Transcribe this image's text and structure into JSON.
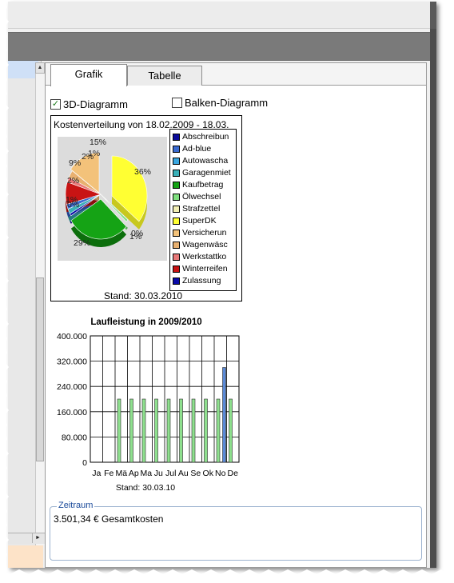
{
  "tabs": [
    {
      "label": "Grafik",
      "active": true
    },
    {
      "label": "Tabelle",
      "active": false
    }
  ],
  "options": {
    "diagram_3d": {
      "label": "3D-Diagramm",
      "checked": true
    },
    "balken": {
      "label": "Balken-Diagramm",
      "checked": false
    }
  },
  "pie": {
    "title": "Kostenverteilung von 18.02.2009 - 18.03.",
    "stand": "Stand: 30.03.2010",
    "slice_labels": [
      "15%",
      "2%",
      "1%",
      "9%",
      "2%",
      "1%",
      "0%",
      "36%",
      "29%",
      "1%",
      "0%"
    ],
    "legend": [
      {
        "label": "Abschreibun",
        "color": "#0a0a9a"
      },
      {
        "label": "Ad-blue",
        "color": "#3a6ad0"
      },
      {
        "label": "Autowascha",
        "color": "#3aa6e0"
      },
      {
        "label": "Garagenmiet",
        "color": "#3ab0b8"
      },
      {
        "label": "Kaufbetrag",
        "color": "#15a315"
      },
      {
        "label": "Ölwechsel",
        "color": "#7fe07f"
      },
      {
        "label": "Strafzettel",
        "color": "#f3efb4"
      },
      {
        "label": "SuperDK",
        "color": "#ffff33"
      },
      {
        "label": "Versicherun",
        "color": "#f3c27a"
      },
      {
        "label": "Wagenwäsc",
        "color": "#e8b070"
      },
      {
        "label": "Werkstattko",
        "color": "#e87878"
      },
      {
        "label": "Winterreifen",
        "color": "#c81414"
      },
      {
        "label": "Zulassung",
        "color": "#0a0aa8"
      }
    ]
  },
  "chart_data": {
    "type": "bar",
    "title": "Laufleistung in 2009/2010",
    "categories": [
      "Ja",
      "Fe",
      "Mä",
      "Ap",
      "Ma",
      "Ju",
      "Jul",
      "Au",
      "Se",
      "Ok",
      "No",
      "De"
    ],
    "series": [
      {
        "values": [
          0,
          0,
          200000,
          200000,
          200000,
          200000,
          200000,
          200000,
          200000,
          200000,
          200000,
          200000
        ],
        "color": "#8ee08e"
      },
      {
        "values": [
          0,
          0,
          0,
          0,
          0,
          0,
          0,
          0,
          0,
          0,
          300000,
          0
        ],
        "color": "#5a8ad8"
      }
    ],
    "ylim": [
      0,
      400000
    ],
    "yticks": [
      "0",
      "80.000",
      "160.000",
      "240.000",
      "320.000",
      "400.000"
    ],
    "xlabel": "Stand: 30.03.10",
    "grid": true
  },
  "zeitraum": {
    "legend": "Zeitraum",
    "summary": "3.501,34 € Gesamtkosten"
  },
  "icons": {
    "scroll_up": "▲",
    "scroll_right": "►",
    "check": "✓"
  }
}
